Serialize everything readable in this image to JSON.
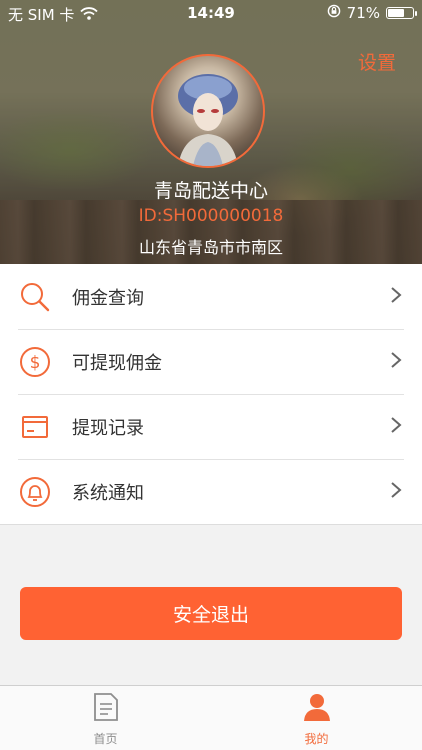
{
  "status_bar": {
    "carrier": "无 SIM 卡",
    "time": "14:49",
    "battery": "71%",
    "battery_level": 0.71
  },
  "header": {
    "settings_label": "设置",
    "name": "青岛配送中心",
    "shop_id": "ID:SH000000018",
    "address": "山东省青岛市市南区"
  },
  "menu": {
    "items": [
      {
        "label": "佣金查询",
        "icon": "search-icon"
      },
      {
        "label": "可提现佣金",
        "icon": "dollar-icon"
      },
      {
        "label": "提现记录",
        "icon": "card-icon"
      },
      {
        "label": "系统通知",
        "icon": "bell-icon"
      }
    ]
  },
  "logout_label": "安全退出",
  "tabbar": {
    "tabs": [
      {
        "label": "首页",
        "icon": "document-icon",
        "active": false
      },
      {
        "label": "我的",
        "icon": "person-icon",
        "active": true
      }
    ]
  },
  "colors": {
    "accent": "#f26a3a",
    "button": "#ff6233",
    "inactive_tab": "#8e8e8e"
  }
}
